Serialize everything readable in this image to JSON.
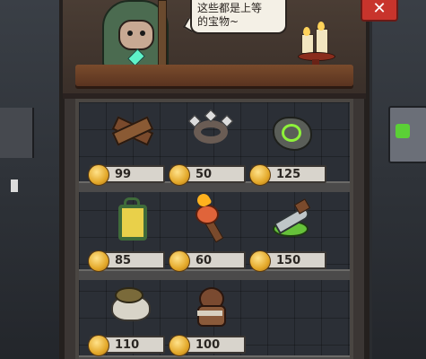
{
  "dialog": {
    "speech_line1": "这些都是上等",
    "speech_line2": "的宝物~"
  },
  "close_button": {
    "label": "✕"
  },
  "shop_items": [
    {
      "icon": "crossed-planks-icon",
      "price": "99"
    },
    {
      "icon": "spiked-collar-icon",
      "price": "50"
    },
    {
      "icon": "rune-stone-icon",
      "price": "125"
    },
    {
      "icon": "lantern-icon",
      "price": "85"
    },
    {
      "icon": "torch-icon",
      "price": "60"
    },
    {
      "icon": "slimy-dagger-icon",
      "price": "150"
    },
    {
      "icon": "stew-pot-icon",
      "price": "110"
    },
    {
      "icon": "voodoo-doll-icon",
      "price": "100"
    }
  ],
  "colors": {
    "coin": "#e3a829",
    "close_button": "#c8342c",
    "price_tag": "#d8d4cc"
  }
}
